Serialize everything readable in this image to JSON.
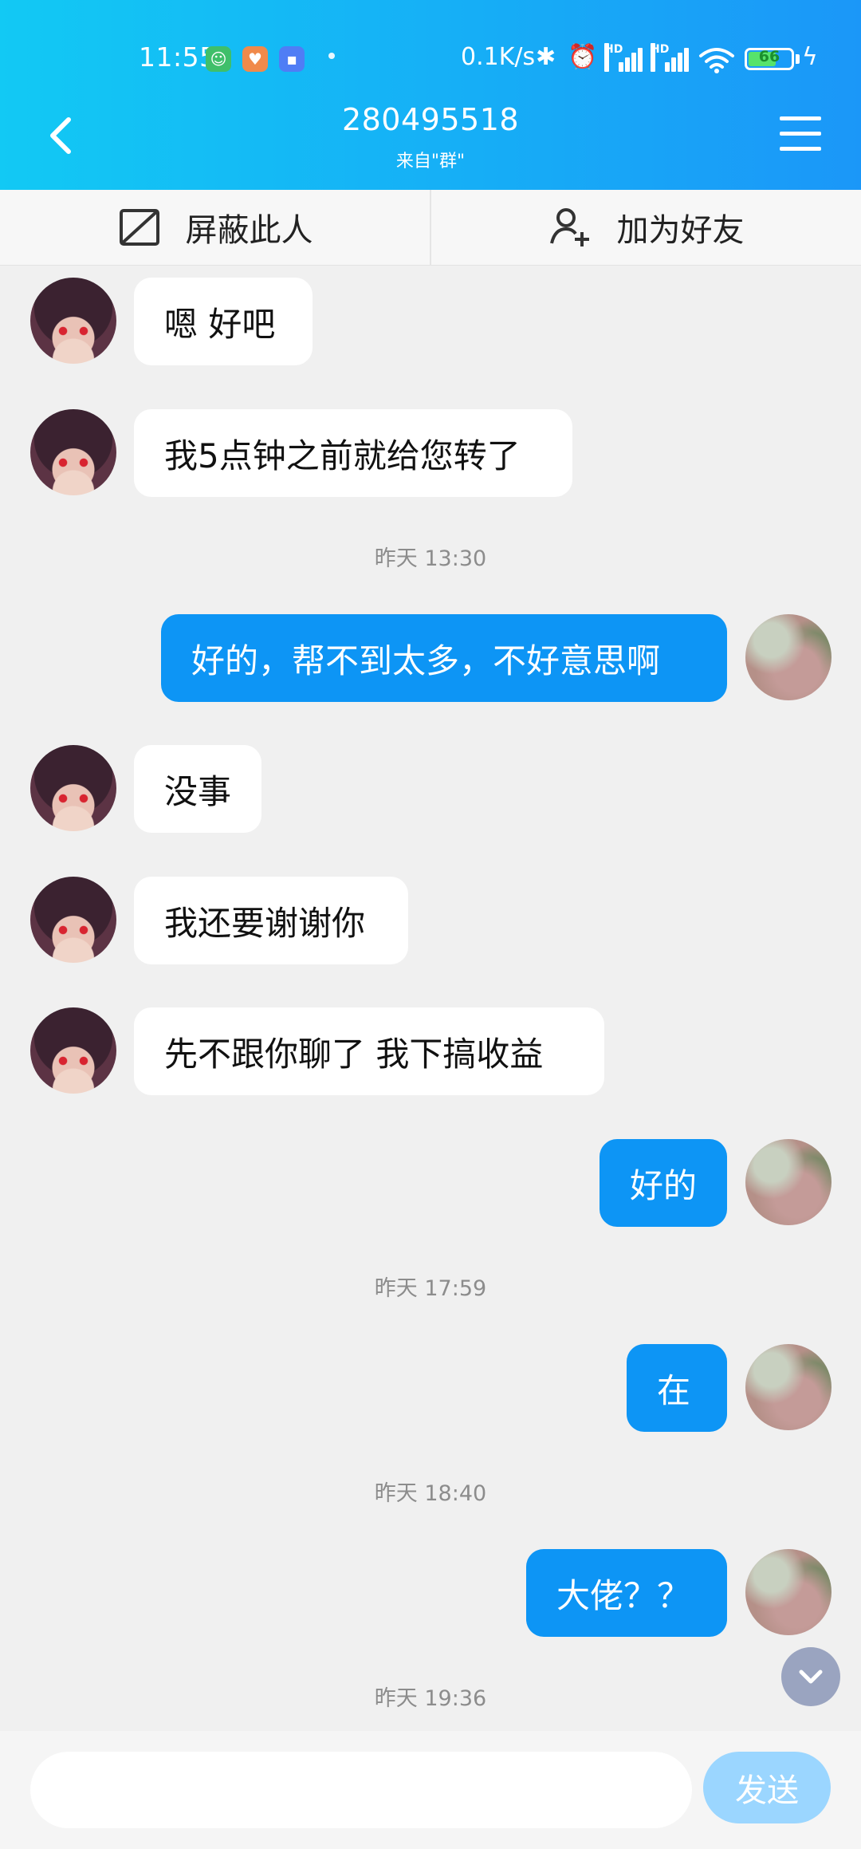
{
  "status_bar": {
    "time": "11:55",
    "net_speed": "0.1K/s",
    "battery": "66",
    "battery_level": 0.66,
    "hd_label": "HD",
    "notification_icons": [
      "robot-app-icon",
      "heart-app-icon",
      "chat-app-icon"
    ]
  },
  "header": {
    "title": "280495518",
    "subtitle": "来自\"群\""
  },
  "actions": {
    "block": "屏蔽此人",
    "add_friend": "加为好友"
  },
  "messages": [
    {
      "sender": "other",
      "text": "嗯 好吧"
    },
    {
      "sender": "other",
      "text": "我5点钟之前就给您转了"
    },
    {
      "type": "timestamp",
      "text": "昨天 13:30"
    },
    {
      "sender": "me",
      "text": "好的，帮不到太多，不好意思啊"
    },
    {
      "sender": "other",
      "text": "没事"
    },
    {
      "sender": "other",
      "text": "我还要谢谢你"
    },
    {
      "sender": "other",
      "text": "先不跟你聊了 我下搞收益"
    },
    {
      "sender": "me",
      "text": "好的"
    },
    {
      "type": "timestamp",
      "text": "昨天 17:59"
    },
    {
      "sender": "me",
      "text": "在"
    },
    {
      "type": "timestamp",
      "text": "昨天 18:40"
    },
    {
      "sender": "me",
      "text": "大佬？？"
    },
    {
      "type": "timestamp",
      "text": "昨天 19:36"
    }
  ],
  "input": {
    "value": "",
    "placeholder": "",
    "send_label": "发送"
  },
  "colors": {
    "header_start": "#12c9f4",
    "header_end": "#1b97f8",
    "my_bubble": "#0d95f5",
    "send_button": "#9bd6ff",
    "background": "#f0f0f0"
  }
}
